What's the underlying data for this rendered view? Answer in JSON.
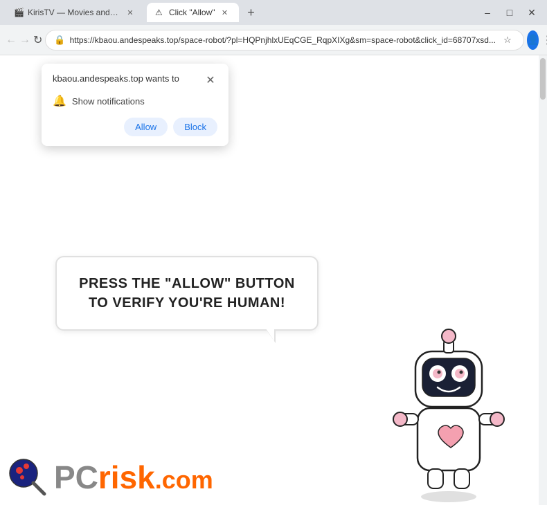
{
  "window": {
    "title_bar_bg": "#dee1e6"
  },
  "tabs": [
    {
      "id": "tab1",
      "label": "KirisTV — Movies and Series D...",
      "active": false,
      "favicon": "🎬"
    },
    {
      "id": "tab2",
      "label": "Click \"Allow\"",
      "active": true,
      "favicon": "⚠"
    }
  ],
  "window_controls": {
    "minimize": "–",
    "restore": "□",
    "close": "✕"
  },
  "address_bar": {
    "url": "https://kbaou.andespeaks.top/space-robot/?pl=HQPnjhlxUEqCGE_RqpXIXg&sm=space-robot&click_id=68707xsd...",
    "lock_icon": "🔒"
  },
  "nav": {
    "back": "←",
    "forward": "→",
    "refresh": "↻"
  },
  "notification_popup": {
    "title": "kbaou.andespeaks.top wants to",
    "close_icon": "✕",
    "notification_row": {
      "bell": "🔔",
      "text": "Show notifications"
    },
    "buttons": {
      "allow": "Allow",
      "block": "Block"
    }
  },
  "page": {
    "speech_text": "PRESS THE \"ALLOW\" BUTTON TO VERIFY YOU'RE HUMAN!"
  },
  "pcrisk": {
    "pc_text": "PC",
    "risk_text": "risk",
    "dotcom_text": ".com"
  }
}
